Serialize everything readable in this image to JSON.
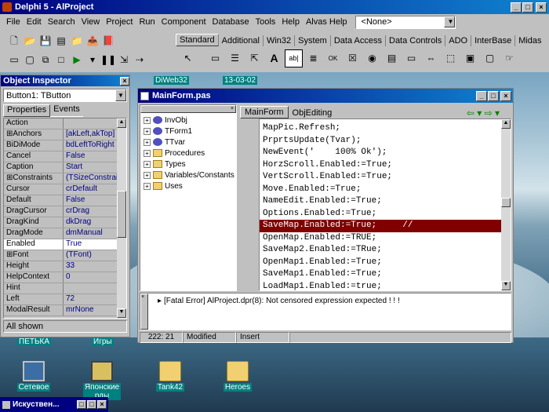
{
  "ide": {
    "title": "Delphi 5 - AlProject",
    "menu": [
      "File",
      "Edit",
      "Search",
      "View",
      "Project",
      "Run",
      "Component",
      "Database",
      "Tools",
      "Help",
      "Alvas Help"
    ],
    "config_combo": "<None>",
    "palette_tabs": [
      "Standard",
      "Additional",
      "Win32",
      "System",
      "Data Access",
      "Data Controls",
      "ADO",
      "InterBase",
      "Midas",
      "In"
    ]
  },
  "inspector": {
    "title": "Object Inspector",
    "object": "Button1: TButton",
    "tabs": [
      "Properties",
      "Events"
    ],
    "rows": [
      {
        "prop": "Action",
        "value": ""
      },
      {
        "prop": "⊞Anchors",
        "value": "[akLeft,akTop]"
      },
      {
        "prop": "BiDiMode",
        "value": "bdLeftToRight"
      },
      {
        "prop": "Cancel",
        "value": "False"
      },
      {
        "prop": "Caption",
        "value": "Start"
      },
      {
        "prop": "⊞Constraints",
        "value": "(TSizeConstrain"
      },
      {
        "prop": "Cursor",
        "value": "crDefault"
      },
      {
        "prop": "Default",
        "value": "False"
      },
      {
        "prop": "DragCursor",
        "value": "crDrag"
      },
      {
        "prop": "DragKind",
        "value": "dkDrag"
      },
      {
        "prop": "DragMode",
        "value": "dmManual"
      },
      {
        "prop": "Enabled",
        "value": "True"
      },
      {
        "prop": "⊞Font",
        "value": "(TFont)"
      },
      {
        "prop": "Height",
        "value": "33"
      },
      {
        "prop": "HelpContext",
        "value": "0"
      },
      {
        "prop": "Hint",
        "value": ""
      },
      {
        "prop": "Left",
        "value": "72"
      },
      {
        "prop": "ModalResult",
        "value": "mrNone"
      }
    ],
    "status": "All shown"
  },
  "editor": {
    "title": "MainForm.pas",
    "tree": [
      "InvObj",
      "TForm1",
      "TTvar",
      "Procedures",
      "Types",
      "Variables/Constants",
      "Uses"
    ],
    "tabs": [
      "MainForm",
      "ObjEditing"
    ],
    "code": [
      "MapPic.Refresh;",
      "PrprtsUpdate(Tvar);",
      "NewEvent('    100% Ok');",
      "HorzScroll.Enabled:=True;",
      "VertScroll.Enabled:=True;",
      "Move.Enabled:=True;",
      "NameEdit.Enabled:=True;",
      "Options.Enabled:=True;",
      "SaveMap.Enabled:=True;     //",
      "OpenMap.Enabled:=TRUE;",
      "SaveMap2.Enabled:=TRue;",
      "OpenMap1.Enabled:=True;",
      "SaveMap1.Enabled:=True;",
      "LoadMap1.Enabled:=true;"
    ],
    "highlight_line": 8,
    "message": "[Fatal Error] AlProject.dpr(8): Not censored expression expected ! ! !",
    "status": {
      "position": "222: 21",
      "modified": "Modified",
      "mode": "Insert"
    }
  },
  "desktop": {
    "top_icons": [
      "DiWeb32",
      "13-03-02"
    ],
    "icons": [
      "Сетевое",
      "Японские\nрды",
      "Tank42",
      "Heroes"
    ],
    "partial_labels": [
      "ПЕТЬКА",
      "Игры"
    ],
    "taskbar_item": "Искуствен..."
  }
}
